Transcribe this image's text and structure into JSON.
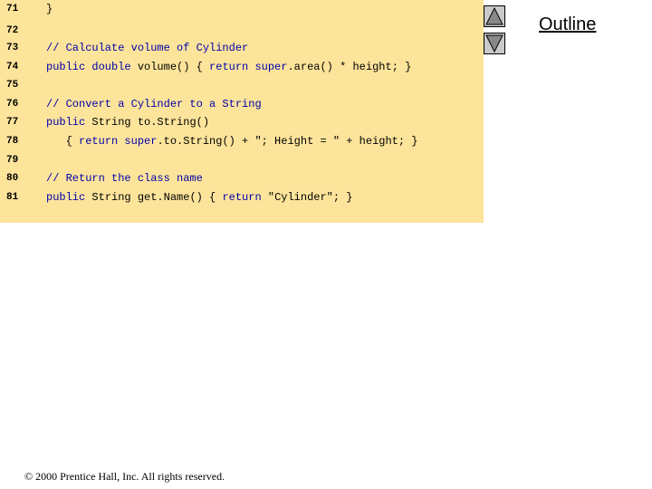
{
  "code": {
    "lines": [
      {
        "num": "71",
        "parts": [
          {
            "t": "}",
            "c": "txt"
          }
        ]
      },
      {
        "num": "72",
        "parts": []
      },
      {
        "num": "73",
        "parts": [
          {
            "t": "// Calculate volume of Cylinder",
            "c": "cm"
          }
        ]
      },
      {
        "num": "74",
        "parts": [
          {
            "t": "public double",
            "c": "kw"
          },
          {
            "t": " volume() { ",
            "c": "txt"
          },
          {
            "t": "return super",
            "c": "kw"
          },
          {
            "t": ".area() * height; }",
            "c": "txt"
          }
        ]
      },
      {
        "num": "75",
        "parts": []
      },
      {
        "num": "76",
        "parts": [
          {
            "t": "// Convert a Cylinder to a String",
            "c": "cm"
          }
        ]
      },
      {
        "num": "77",
        "parts": [
          {
            "t": "public",
            "c": "kw"
          },
          {
            "t": " String to.String()",
            "c": "txt"
          }
        ]
      },
      {
        "num": "78",
        "parts": [
          {
            "t": "   { ",
            "c": "txt"
          },
          {
            "t": "return super",
            "c": "kw"
          },
          {
            "t": ".to.String() + \"; Height = \" + height; }",
            "c": "txt"
          }
        ]
      },
      {
        "num": "79",
        "parts": []
      },
      {
        "num": "80",
        "parts": [
          {
            "t": "// Return the class name",
            "c": "cm"
          }
        ]
      },
      {
        "num": "81",
        "parts": [
          {
            "t": "public",
            "c": "kw"
          },
          {
            "t": " String get.Name() { ",
            "c": "txt"
          },
          {
            "t": "return",
            "c": "kw"
          },
          {
            "t": " \"Cylinder\"; }",
            "c": "txt"
          }
        ]
      }
    ]
  },
  "nav": {
    "up_icon": "triangle-up-icon",
    "down_icon": "triangle-down-icon"
  },
  "outline_label": "Outline",
  "footer": {
    "copyright_symbol": "©",
    "copyright_text": " 2000 Prentice Hall, Inc.  All rights reserved."
  },
  "colors": {
    "code_background": "#fde49b",
    "keyword": "#0000aa",
    "button_fill": "#c9c9c9"
  }
}
